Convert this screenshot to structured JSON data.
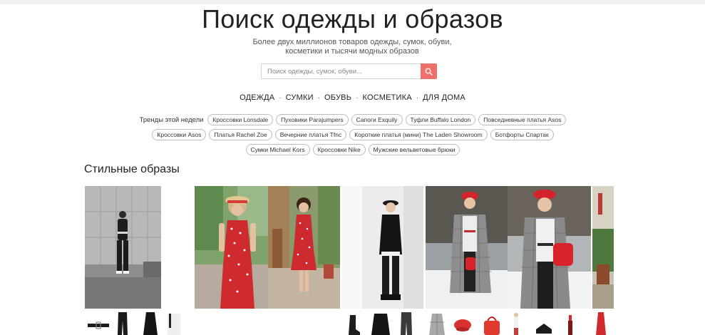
{
  "header": {
    "title": "Поиск одежды и образов",
    "subtitle_line1": "Более двух миллионов товаров одежды, сумок, обуви,",
    "subtitle_line2": "косметики и тысячи модных образов"
  },
  "search": {
    "placeholder": "Поиск одежды, сумок, обуви...",
    "value": "",
    "button_icon": "search-icon",
    "button_color": "#f0716b"
  },
  "categories": [
    "ОДЕЖДА",
    "СУМКИ",
    "ОБУВЬ",
    "КОСМЕТИКА",
    "ДЛЯ ДОМА"
  ],
  "trends": {
    "label": "Тренды этой недели",
    "rows": [
      [
        "Кроссовки Lonsdale",
        "Пуховики Parajumpers",
        "Сапоги Exquily",
        "Туфли Buffalo London",
        "Повседневные платья Asos"
      ],
      [
        "Кроссовки Asos",
        "Платья Rachel Zoe",
        "Вечерние платья Tfnc",
        "Короткие платья (мини) The Laden Showroom",
        "Ботфорты Спартак"
      ],
      [
        "Сумки Michael Kors",
        "Кроссовки Nike",
        "Мужские вельветовые брюки"
      ]
    ]
  },
  "looks_section": {
    "title": "Стильные образы"
  },
  "looks": [
    {
      "name": "look-black-jumpsuit",
      "icon": "photo-urban-black-outfit"
    },
    {
      "name": "look-red-polka-dress-1",
      "icon": "photo-red-polka-dress"
    },
    {
      "name": "look-red-polka-dress-2",
      "icon": "photo-red-polka-dress"
    },
    {
      "name": "look-black-minimal",
      "icon": "photo-black-outfit-studio"
    },
    {
      "name": "look-red-beret-winter-1",
      "icon": "photo-winter-red-beret"
    },
    {
      "name": "look-red-beret-winter-2",
      "icon": "photo-winter-red-beret"
    },
    {
      "name": "look-red-partial",
      "icon": "photo-partial"
    }
  ],
  "colors": {
    "accent": "#f0716b",
    "tag_border": "#bdbdbd",
    "text": "#222222"
  }
}
